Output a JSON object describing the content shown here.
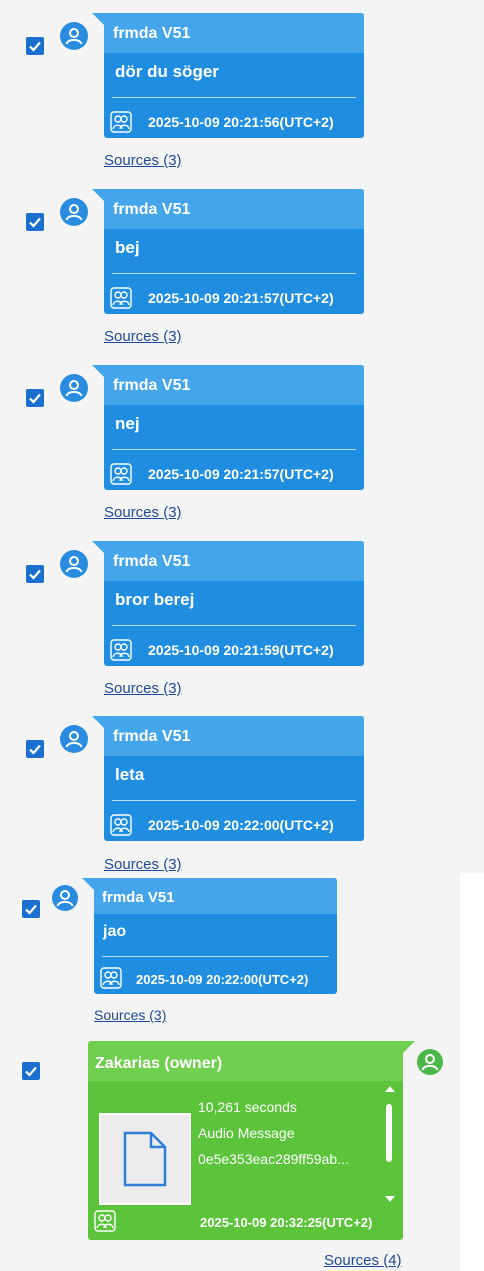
{
  "messages": [
    {
      "sender": "frmda V51",
      "text": "dör du söger",
      "timestamp": "2025-10-09 20:21:56(UTC+2)",
      "sources": "Sources (3)"
    },
    {
      "sender": "frmda V51",
      "text": "bej",
      "timestamp": "2025-10-09 20:21:57(UTC+2)",
      "sources": "Sources (3)"
    },
    {
      "sender": "frmda V51",
      "text": "nej",
      "timestamp": "2025-10-09 20:21:57(UTC+2)",
      "sources": "Sources (3)"
    },
    {
      "sender": "frmda V51",
      "text": "bror berej",
      "timestamp": "2025-10-09 20:21:59(UTC+2)",
      "sources": "Sources (3)"
    },
    {
      "sender": "frmda V51",
      "text": "leta",
      "timestamp": "2025-10-09 20:22:00(UTC+2)",
      "sources": "Sources (3)"
    },
    {
      "sender": "frmda V51",
      "text": "jao",
      "timestamp": "2025-10-09 20:22:00(UTC+2)",
      "sources": "Sources (3)"
    }
  ],
  "owner_message": {
    "sender": "Zakarias (owner)",
    "duration": "10,261 seconds",
    "type": "Audio Message",
    "file_id": "0e5e353eac289ff59ab...",
    "timestamp": "2025-10-09 20:32:25(UTC+2)",
    "sources": "Sources (4)",
    "icon": "file-icon"
  },
  "colors": {
    "incoming_bubble": "#1f8ee1",
    "incoming_header": "#44a5ea",
    "owner_bubble": "#5cc43b",
    "checkbox": "#1a6fcf",
    "link": "#1f4a96"
  }
}
